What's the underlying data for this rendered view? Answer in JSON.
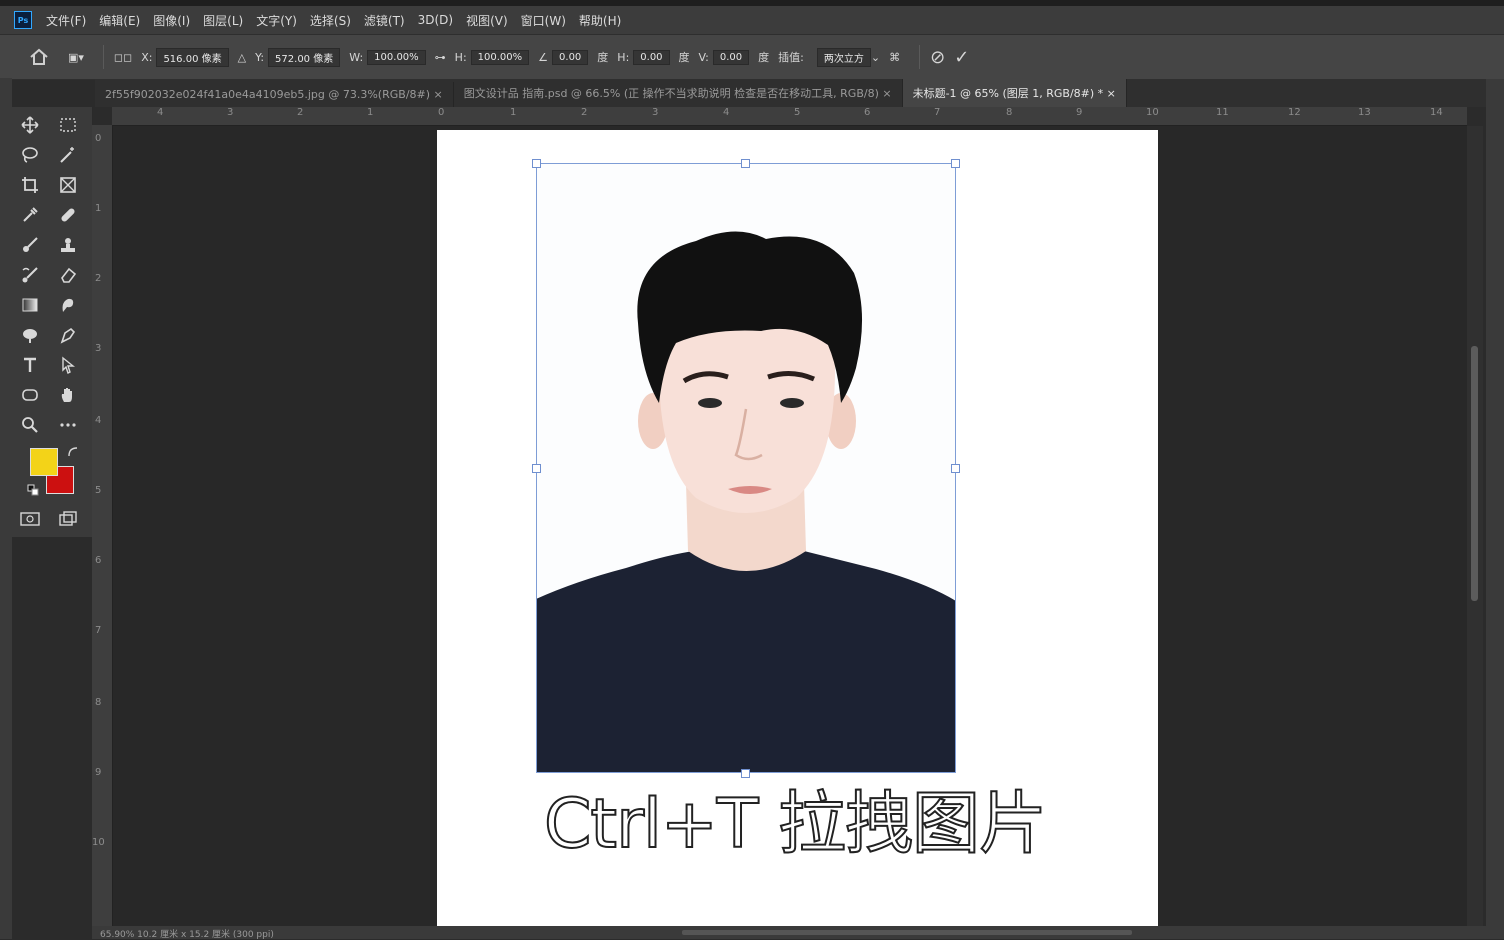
{
  "app": {
    "logo": "Ps"
  },
  "menu": [
    "文件(F)",
    "编辑(E)",
    "图像(I)",
    "图层(L)",
    "文字(Y)",
    "选择(S)",
    "滤镜(T)",
    "3D(D)",
    "视图(V)",
    "窗口(W)",
    "帮助(H)"
  ],
  "options": {
    "x_label": "X:",
    "x_value": "516.00 像素",
    "y_label": "Y:",
    "y_value": "572.00 像素",
    "w_label": "W:",
    "w_value": "100.00%",
    "h_label": "H:",
    "h_value": "100.00%",
    "angle_value": "0.00",
    "angle_unit": "度",
    "hskew_label": "H:",
    "hskew_value": "0.00",
    "hskew_unit": "度",
    "vskew_label": "V:",
    "vskew_value": "0.00",
    "vskew_unit": "度",
    "interp_label": "插值:",
    "interp_value": "两次立方"
  },
  "tabs": [
    {
      "label": "2f55f902032e024f41a0e4a4109eb5.jpg @ 73.3%(RGB/8#) ×"
    },
    {
      "label": "图文设计品 指南.psd @ 66.5% (正 操作不当求助说明 检查是否在移动工具, RGB/8) ×"
    },
    {
      "label": "未标题-1 @ 65% (图层 1, RGB/8#) * ×"
    }
  ],
  "colors": {
    "foreground": "#f3d318",
    "background": "#cc1010",
    "accent": "#31a8ff"
  },
  "ruler_top": [
    "4",
    "3",
    "2",
    "1",
    "0",
    "1",
    "2",
    "3",
    "4",
    "5",
    "6",
    "7",
    "8",
    "9",
    "10",
    "11",
    "12",
    "13",
    "14"
  ],
  "ruler_left": [
    "0",
    "1",
    "2",
    "3",
    "4",
    "5",
    "6",
    "7",
    "8",
    "9",
    "10"
  ],
  "caption": "Ctrl+T 拉拽图片",
  "status": "65.90%    10.2 厘米 x 15.2 厘米 (300 ppi)"
}
